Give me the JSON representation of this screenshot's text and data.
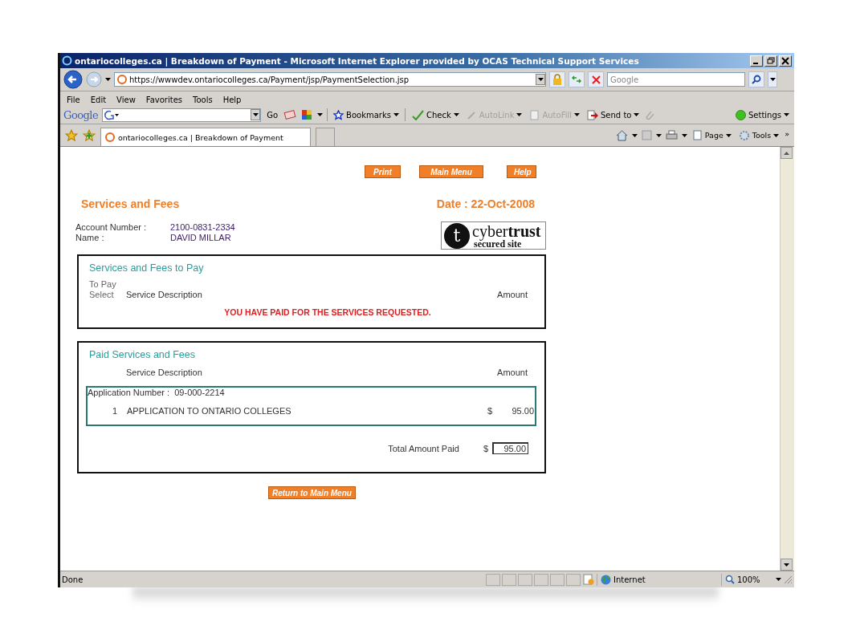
{
  "window": {
    "title": "ontariocolleges.ca | Breakdown of Payment - Microsoft Internet Explorer provided by OCAS Technical Support Services"
  },
  "address_bar": {
    "url": "https://wwwdev.ontariocolleges.ca/Payment/jsp/PaymentSelection.jsp"
  },
  "search": {
    "placeholder": "Google"
  },
  "menu": [
    "File",
    "Edit",
    "View",
    "Favorites",
    "Tools",
    "Help"
  ],
  "google_toolbar": {
    "logo": "Google",
    "go": "Go",
    "items": [
      {
        "kind": "bookmarks",
        "label": "Bookmarks",
        "disabled": false
      },
      {
        "kind": "check",
        "label": "Check",
        "disabled": false
      },
      {
        "kind": "autolink",
        "label": "AutoLink",
        "disabled": true
      },
      {
        "kind": "autofill",
        "label": "AutoFill",
        "disabled": true
      },
      {
        "kind": "sendto",
        "label": "Send to",
        "disabled": false
      }
    ],
    "settings": "Settings"
  },
  "tab": {
    "label": "ontariocolleges.ca | Breakdown of Payment"
  },
  "command_bar": {
    "page": "Page",
    "tools": "Tools",
    "more": "»"
  },
  "page": {
    "buttons": [
      "Print",
      "Main Menu",
      "Help"
    ],
    "heading": "Services and Fees",
    "date": "Date : 22-Oct-2008",
    "account": [
      {
        "label": "Account Number :",
        "value": "2100-0831-2334"
      },
      {
        "label": "Name :",
        "value": "DAVID MILLAR"
      }
    ],
    "seal": {
      "mark": "t",
      "brand_light": "cyber",
      "brand_bold": "trust",
      "caption": "secured site"
    },
    "to_pay": {
      "title": "Services and Fees to Pay",
      "col_to_pay": "To Pay",
      "col_select": "Select",
      "col_description": "Service Description",
      "col_amount": "Amount",
      "message": "YOU HAVE PAID FOR THE SERVICES REQUESTED."
    },
    "paid": {
      "title": "Paid Services and Fees",
      "col_description": "Service Description",
      "col_amount": "Amount",
      "application_label": "Application Number :",
      "application_number": "09-000-2214",
      "rows": [
        {
          "index": "1",
          "description": "APPLICATION TO ONTARIO COLLEGES",
          "currency": "$",
          "amount": "95.00"
        }
      ],
      "total_label": "Total Amount Paid",
      "total_currency": "$",
      "total": "95.00"
    },
    "return_button": "Return to Main Menu"
  },
  "status_bar": {
    "text": "Done",
    "zone": "Internet",
    "zoom": "100%"
  }
}
